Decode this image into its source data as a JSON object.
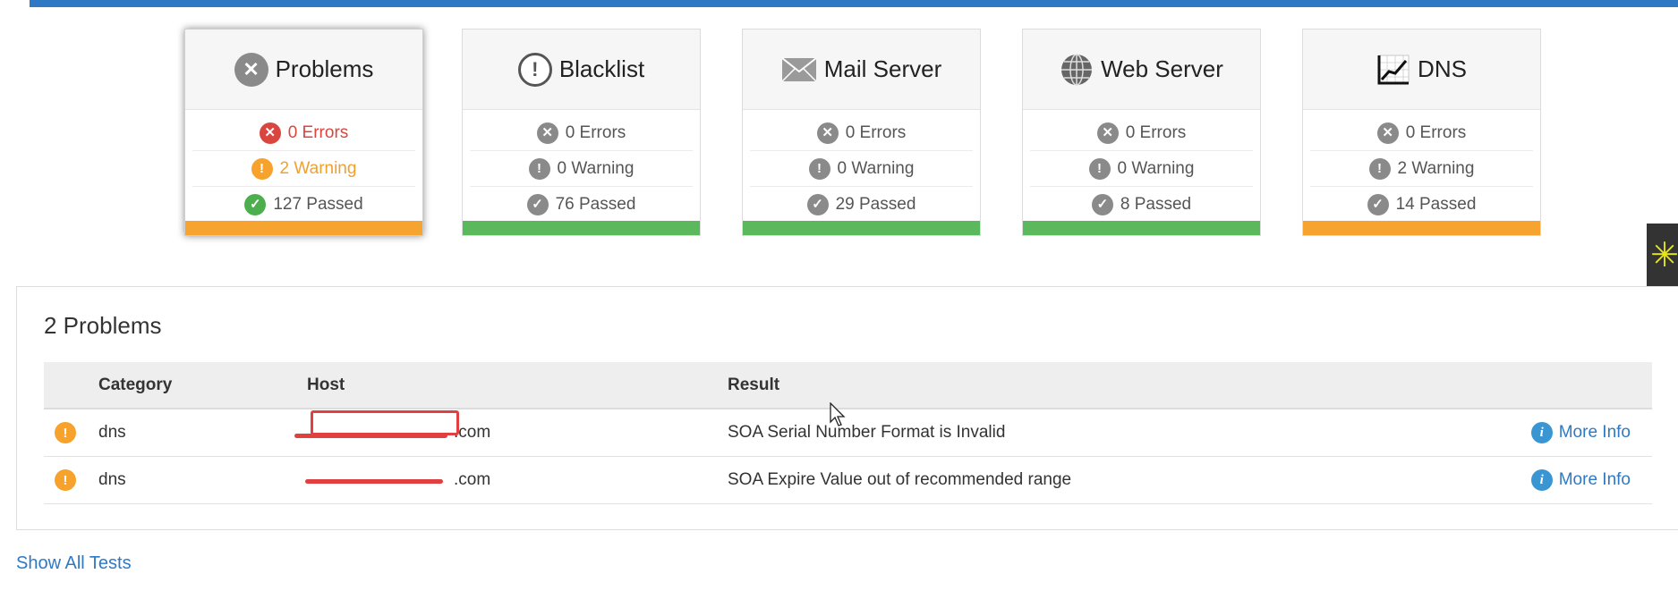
{
  "cards": [
    {
      "title": "Problems",
      "icon": "x-circle-icon",
      "errors": "0 Errors",
      "warnings": "2 Warning",
      "passed": "127 Passed",
      "bar": "#f7a330"
    },
    {
      "title": "Blacklist",
      "icon": "exclamation-circle-icon",
      "errors": "0 Errors",
      "warnings": "0 Warning",
      "passed": "76 Passed",
      "bar": "#5cb85c"
    },
    {
      "title": "Mail Server",
      "icon": "envelope-icon",
      "errors": "0 Errors",
      "warnings": "0 Warning",
      "passed": "29 Passed",
      "bar": "#5cb85c"
    },
    {
      "title": "Web Server",
      "icon": "globe-icon",
      "errors": "0 Errors",
      "warnings": "0 Warning",
      "passed": "8 Passed",
      "bar": "#5cb85c"
    },
    {
      "title": "DNS",
      "icon": "chart-line-icon",
      "errors": "0 Errors",
      "warnings": "2 Warning",
      "passed": "14 Passed",
      "bar": "#f7a330"
    }
  ],
  "problems": {
    "title": "2 Problems",
    "headers": {
      "category": "Category",
      "host": "Host",
      "result": "Result"
    },
    "rows": [
      {
        "category": "dns",
        "host_suffix": ".com",
        "result": "SOA Serial Number Format is Invalid",
        "action": "More Info"
      },
      {
        "category": "dns",
        "host_suffix": ".com",
        "result": "SOA Expire Value out of recommended range",
        "action": "More Info"
      }
    ]
  },
  "show_all": "Show All Tests",
  "colors": {
    "accent": "#2f79c4",
    "warning": "#f7a330",
    "pass": "#5cb85c",
    "error": "#d9453f"
  }
}
